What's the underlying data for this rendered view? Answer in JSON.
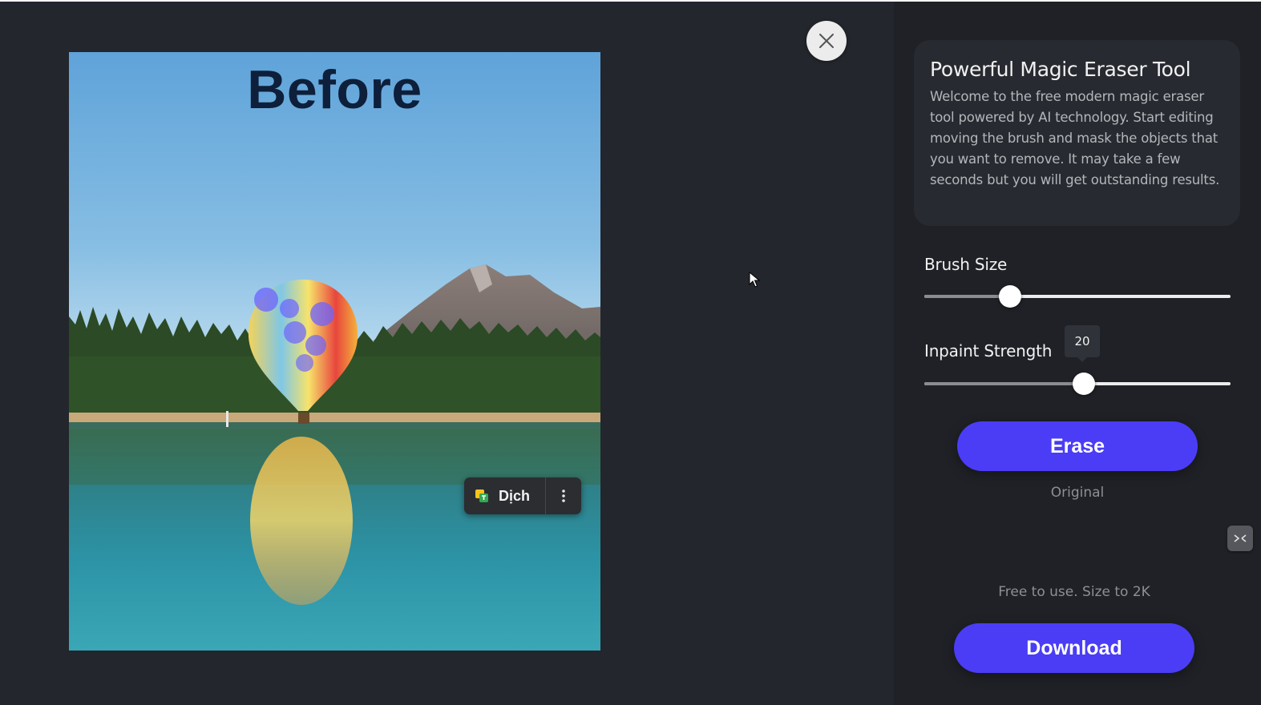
{
  "editor": {
    "image_label": "Before"
  },
  "translate_popup": {
    "label": "Dịch"
  },
  "panel": {
    "title": "Powerful Magic Eraser Tool",
    "description": "Welcome to the free modern magic eraser tool powered by AI technology. Start editing moving the brush and mask the objects that you want to remove. It may take a few seconds but you will get outstanding results.",
    "brush_size": {
      "label": "Brush Size",
      "level": 0.28
    },
    "inpaint_strength": {
      "label": "Inpaint Strength",
      "value": "20",
      "level": 0.52
    },
    "erase_label": "Erase",
    "original_label": "Original",
    "free_note": "Free to use. Size to 2K",
    "download_label": "Download"
  },
  "colors": {
    "accent": "#4a3df5",
    "background": "#23262c",
    "panel": "#1f2126"
  },
  "icons": {
    "close": "close-icon",
    "translate": "translate-icon",
    "more": "more-vertical-icon",
    "cursor": "mouse-pointer-icon",
    "side_widget": "chat-widget-icon"
  }
}
